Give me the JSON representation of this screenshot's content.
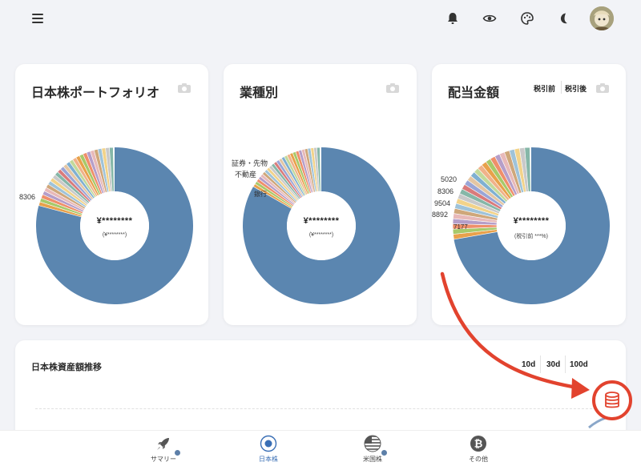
{
  "header": {
    "menu_icon": "hamburger-icon",
    "icons": [
      "bell-icon",
      "eye-icon",
      "palette-icon",
      "moon-icon"
    ],
    "avatar": "avatar"
  },
  "cards": {
    "portfolio": {
      "title": "日本株ポートフォリオ",
      "center_main": "¥********",
      "center_sub": "(¥********)",
      "labels": [
        "8306"
      ]
    },
    "sector": {
      "title": "業種別",
      "center_main": "¥********",
      "center_sub": "(¥********)",
      "labels": [
        "証券・先物",
        "不動産",
        "銀行"
      ]
    },
    "dividend": {
      "title": "配当金額",
      "toggle_pre": "税引前",
      "toggle_post": "税引後",
      "center_main": "¥********",
      "center_sub": "(税引前 ***%)",
      "labels": [
        "5020",
        "8306",
        "9504",
        "8892",
        "7177"
      ]
    }
  },
  "history": {
    "title": "日本株資産額推移",
    "ranges": [
      "10d",
      "30d",
      "100d"
    ]
  },
  "bottom_nav": {
    "items": [
      {
        "label": "サマリー",
        "icon": "rocket-icon"
      },
      {
        "label": "日本株",
        "icon": "circle-target-icon"
      },
      {
        "label": "米国株",
        "icon": "us-flag-icon"
      },
      {
        "label": "その他",
        "icon": "bitcoin-icon"
      }
    ]
  },
  "colors": {
    "accent": "#3a6fb5",
    "donut_main": "#5b86b0",
    "annotation": "#e2432e"
  },
  "database_button_icon": "database-icon"
}
